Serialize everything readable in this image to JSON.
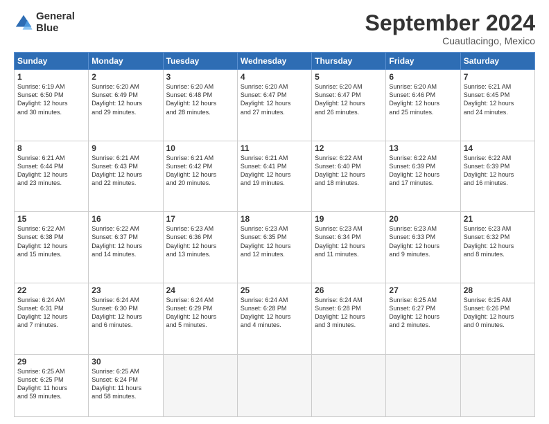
{
  "logo": {
    "line1": "General",
    "line2": "Blue"
  },
  "title": "September 2024",
  "subtitle": "Cuautlacingo, Mexico",
  "days_header": [
    "Sunday",
    "Monday",
    "Tuesday",
    "Wednesday",
    "Thursday",
    "Friday",
    "Saturday"
  ],
  "weeks": [
    [
      {
        "day": "1",
        "info": "Sunrise: 6:19 AM\nSunset: 6:50 PM\nDaylight: 12 hours\nand 30 minutes."
      },
      {
        "day": "2",
        "info": "Sunrise: 6:20 AM\nSunset: 6:49 PM\nDaylight: 12 hours\nand 29 minutes."
      },
      {
        "day": "3",
        "info": "Sunrise: 6:20 AM\nSunset: 6:48 PM\nDaylight: 12 hours\nand 28 minutes."
      },
      {
        "day": "4",
        "info": "Sunrise: 6:20 AM\nSunset: 6:47 PM\nDaylight: 12 hours\nand 27 minutes."
      },
      {
        "day": "5",
        "info": "Sunrise: 6:20 AM\nSunset: 6:47 PM\nDaylight: 12 hours\nand 26 minutes."
      },
      {
        "day": "6",
        "info": "Sunrise: 6:20 AM\nSunset: 6:46 PM\nDaylight: 12 hours\nand 25 minutes."
      },
      {
        "day": "7",
        "info": "Sunrise: 6:21 AM\nSunset: 6:45 PM\nDaylight: 12 hours\nand 24 minutes."
      }
    ],
    [
      {
        "day": "8",
        "info": "Sunrise: 6:21 AM\nSunset: 6:44 PM\nDaylight: 12 hours\nand 23 minutes."
      },
      {
        "day": "9",
        "info": "Sunrise: 6:21 AM\nSunset: 6:43 PM\nDaylight: 12 hours\nand 22 minutes."
      },
      {
        "day": "10",
        "info": "Sunrise: 6:21 AM\nSunset: 6:42 PM\nDaylight: 12 hours\nand 20 minutes."
      },
      {
        "day": "11",
        "info": "Sunrise: 6:21 AM\nSunset: 6:41 PM\nDaylight: 12 hours\nand 19 minutes."
      },
      {
        "day": "12",
        "info": "Sunrise: 6:22 AM\nSunset: 6:40 PM\nDaylight: 12 hours\nand 18 minutes."
      },
      {
        "day": "13",
        "info": "Sunrise: 6:22 AM\nSunset: 6:39 PM\nDaylight: 12 hours\nand 17 minutes."
      },
      {
        "day": "14",
        "info": "Sunrise: 6:22 AM\nSunset: 6:39 PM\nDaylight: 12 hours\nand 16 minutes."
      }
    ],
    [
      {
        "day": "15",
        "info": "Sunrise: 6:22 AM\nSunset: 6:38 PM\nDaylight: 12 hours\nand 15 minutes."
      },
      {
        "day": "16",
        "info": "Sunrise: 6:22 AM\nSunset: 6:37 PM\nDaylight: 12 hours\nand 14 minutes."
      },
      {
        "day": "17",
        "info": "Sunrise: 6:23 AM\nSunset: 6:36 PM\nDaylight: 12 hours\nand 13 minutes."
      },
      {
        "day": "18",
        "info": "Sunrise: 6:23 AM\nSunset: 6:35 PM\nDaylight: 12 hours\nand 12 minutes."
      },
      {
        "day": "19",
        "info": "Sunrise: 6:23 AM\nSunset: 6:34 PM\nDaylight: 12 hours\nand 11 minutes."
      },
      {
        "day": "20",
        "info": "Sunrise: 6:23 AM\nSunset: 6:33 PM\nDaylight: 12 hours\nand 9 minutes."
      },
      {
        "day": "21",
        "info": "Sunrise: 6:23 AM\nSunset: 6:32 PM\nDaylight: 12 hours\nand 8 minutes."
      }
    ],
    [
      {
        "day": "22",
        "info": "Sunrise: 6:24 AM\nSunset: 6:31 PM\nDaylight: 12 hours\nand 7 minutes."
      },
      {
        "day": "23",
        "info": "Sunrise: 6:24 AM\nSunset: 6:30 PM\nDaylight: 12 hours\nand 6 minutes."
      },
      {
        "day": "24",
        "info": "Sunrise: 6:24 AM\nSunset: 6:29 PM\nDaylight: 12 hours\nand 5 minutes."
      },
      {
        "day": "25",
        "info": "Sunrise: 6:24 AM\nSunset: 6:28 PM\nDaylight: 12 hours\nand 4 minutes."
      },
      {
        "day": "26",
        "info": "Sunrise: 6:24 AM\nSunset: 6:28 PM\nDaylight: 12 hours\nand 3 minutes."
      },
      {
        "day": "27",
        "info": "Sunrise: 6:25 AM\nSunset: 6:27 PM\nDaylight: 12 hours\nand 2 minutes."
      },
      {
        "day": "28",
        "info": "Sunrise: 6:25 AM\nSunset: 6:26 PM\nDaylight: 12 hours\nand 0 minutes."
      }
    ],
    [
      {
        "day": "29",
        "info": "Sunrise: 6:25 AM\nSunset: 6:25 PM\nDaylight: 11 hours\nand 59 minutes."
      },
      {
        "day": "30",
        "info": "Sunrise: 6:25 AM\nSunset: 6:24 PM\nDaylight: 11 hours\nand 58 minutes."
      },
      {
        "day": "",
        "info": ""
      },
      {
        "day": "",
        "info": ""
      },
      {
        "day": "",
        "info": ""
      },
      {
        "day": "",
        "info": ""
      },
      {
        "day": "",
        "info": ""
      }
    ]
  ]
}
